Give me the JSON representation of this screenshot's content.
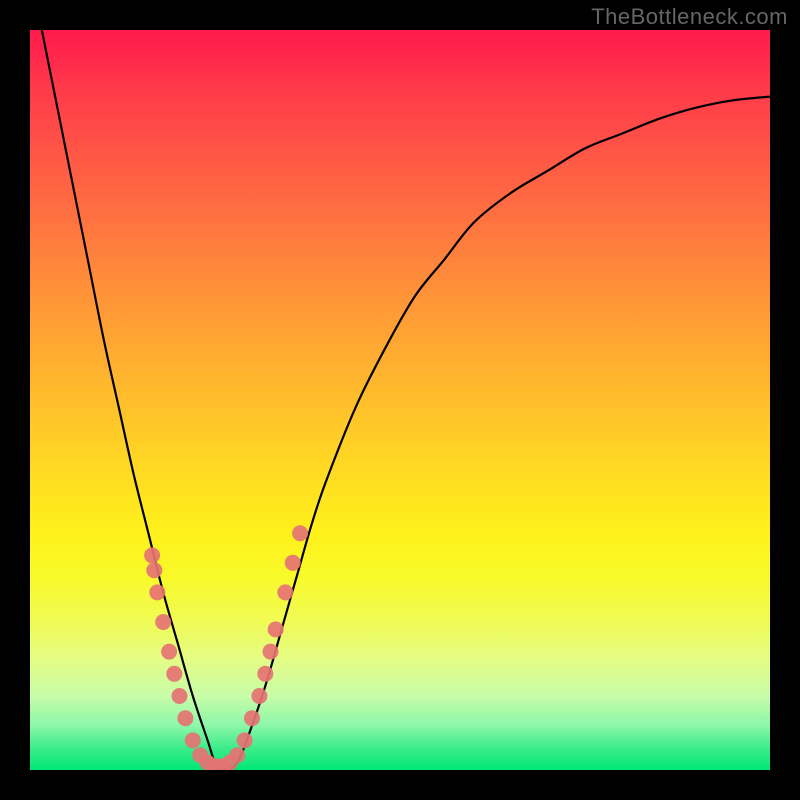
{
  "watermark": "TheBottleneck.com",
  "chart_data": {
    "type": "line",
    "title": "",
    "xlabel": "",
    "ylabel": "",
    "xlim": [
      0,
      100
    ],
    "ylim": [
      0,
      100
    ],
    "grid": false,
    "legend": false,
    "series": [
      {
        "name": "bottleneck-curve",
        "x": [
          0,
          2,
          4,
          6,
          8,
          10,
          12,
          14,
          16,
          18,
          20,
          22,
          24,
          25,
          26,
          28,
          30,
          32,
          34,
          36,
          38,
          40,
          44,
          48,
          52,
          56,
          60,
          65,
          70,
          75,
          80,
          85,
          90,
          95,
          100
        ],
        "y": [
          108,
          98,
          88,
          78,
          68,
          58,
          49,
          40,
          32,
          24,
          17,
          10,
          4,
          1,
          0,
          1,
          6,
          12,
          19,
          26,
          33,
          39,
          49,
          57,
          64,
          69,
          74,
          78,
          81,
          84,
          86,
          88,
          89.5,
          90.5,
          91
        ]
      }
    ],
    "markers": [
      {
        "name": "cluster-left",
        "points": [
          {
            "x": 16.5,
            "y": 29
          },
          {
            "x": 16.8,
            "y": 27
          },
          {
            "x": 17.2,
            "y": 24
          },
          {
            "x": 18.0,
            "y": 20
          },
          {
            "x": 18.8,
            "y": 16
          },
          {
            "x": 19.5,
            "y": 13
          },
          {
            "x": 20.2,
            "y": 10
          },
          {
            "x": 21.0,
            "y": 7
          },
          {
            "x": 22.0,
            "y": 4
          },
          {
            "x": 23.0,
            "y": 2
          },
          {
            "x": 24.0,
            "y": 1
          },
          {
            "x": 25.0,
            "y": 0.5
          },
          {
            "x": 26.0,
            "y": 0.5
          },
          {
            "x": 27.0,
            "y": 1
          }
        ]
      },
      {
        "name": "cluster-right",
        "points": [
          {
            "x": 28.0,
            "y": 2
          },
          {
            "x": 29.0,
            "y": 4
          },
          {
            "x": 30.0,
            "y": 7
          },
          {
            "x": 31.0,
            "y": 10
          },
          {
            "x": 31.8,
            "y": 13
          },
          {
            "x": 32.5,
            "y": 16
          },
          {
            "x": 33.2,
            "y": 19
          },
          {
            "x": 34.5,
            "y": 24
          },
          {
            "x": 35.5,
            "y": 28
          },
          {
            "x": 36.5,
            "y": 32
          }
        ]
      }
    ],
    "marker_style": {
      "color": "#e57373",
      "radius": 8
    }
  }
}
